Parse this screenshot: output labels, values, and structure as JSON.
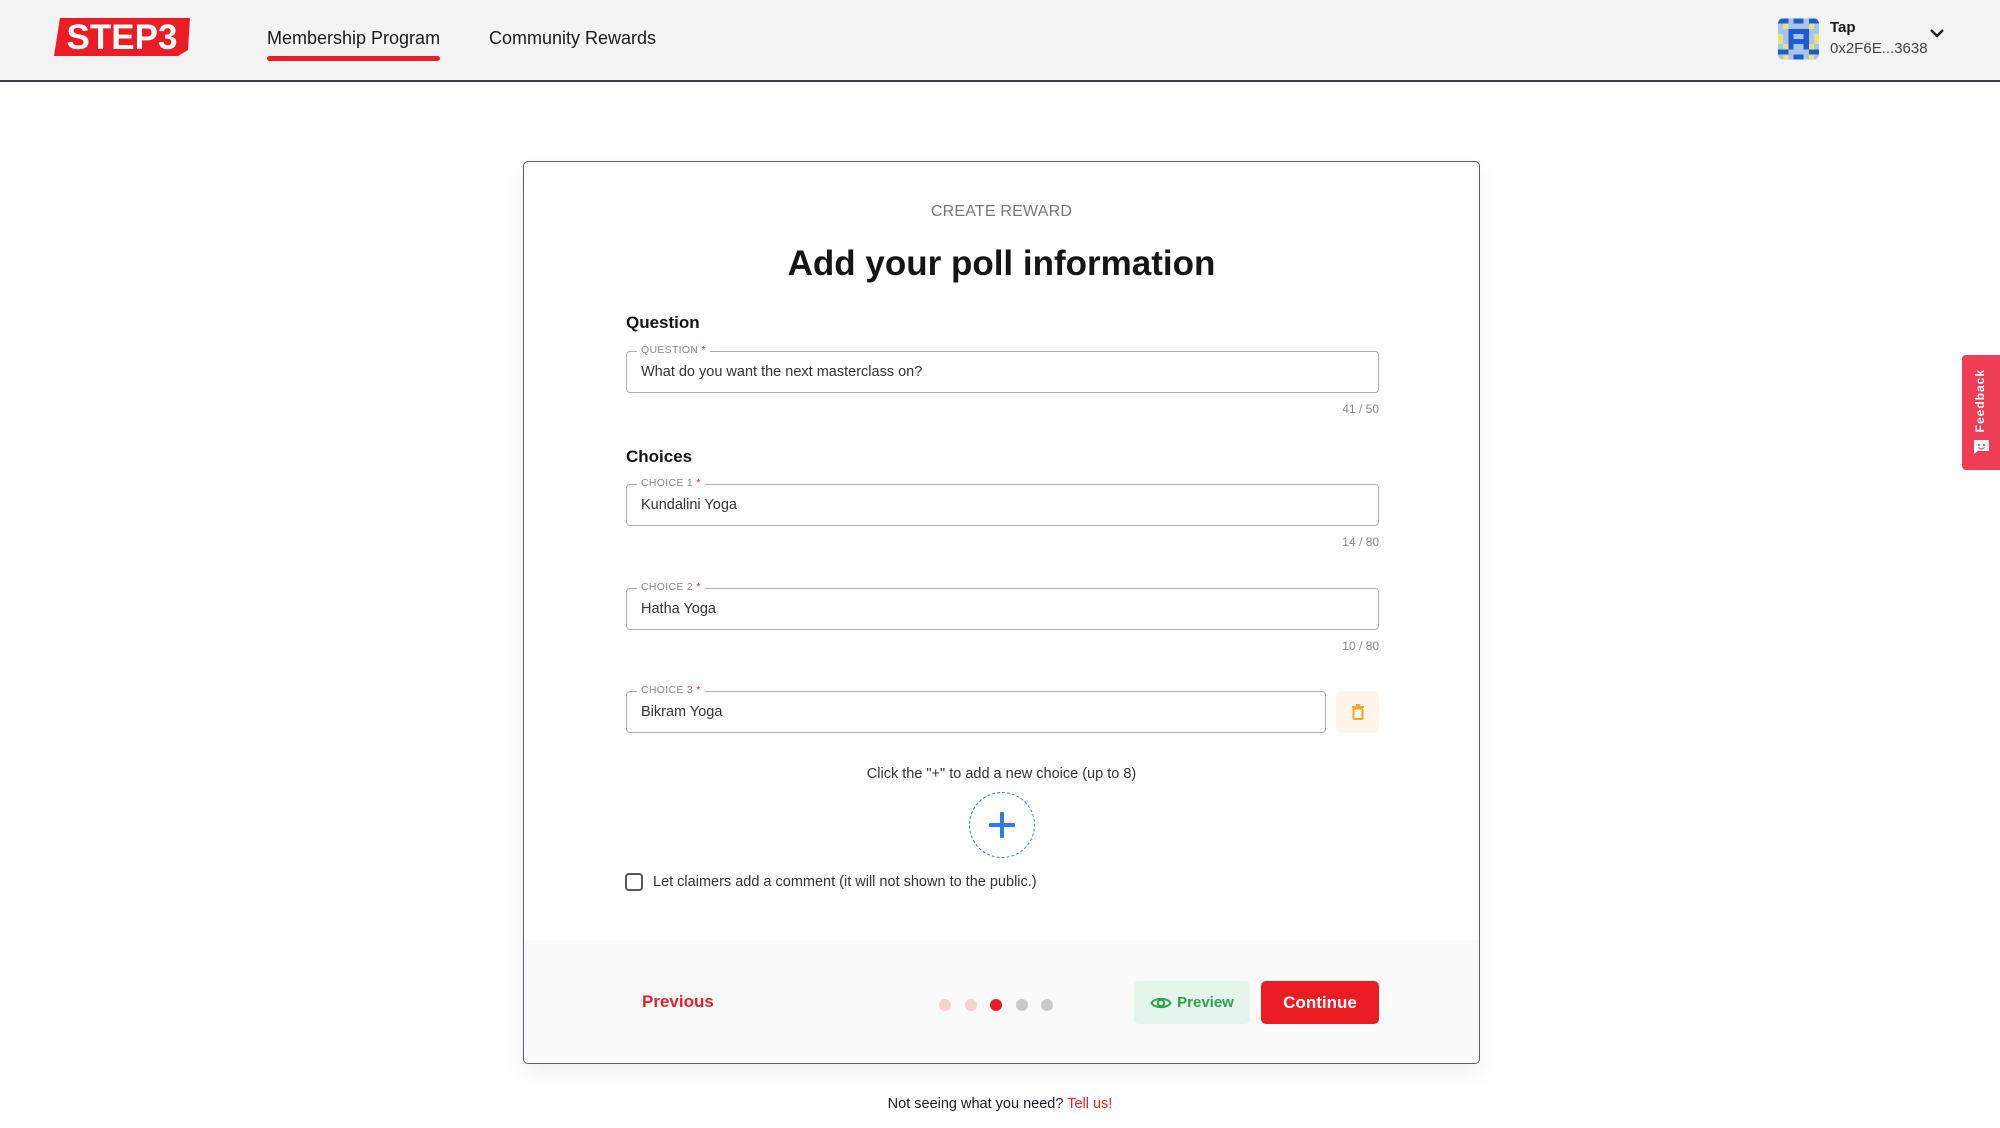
{
  "header": {
    "logo_text": "STEP3",
    "nav": [
      {
        "label": "Membership Program",
        "active": true
      },
      {
        "label": "Community Rewards",
        "active": false
      }
    ],
    "user": {
      "name": "Tap",
      "address": "0x2F6E...3638"
    }
  },
  "card": {
    "eyebrow": "CREATE REWARD",
    "title": "Add your poll information",
    "question_section": "Question",
    "question": {
      "legend": "QUESTION",
      "required_mark": "*",
      "value": "What do you want the next masterclass on?",
      "counter": "41 / 50"
    },
    "choices_section": "Choices",
    "choices": [
      {
        "legend": "CHOICE 1",
        "required_mark": "*",
        "value": "Kundalini Yoga",
        "counter": "14 / 80"
      },
      {
        "legend": "CHOICE 2",
        "required_mark": "*",
        "value": "Hatha Yoga",
        "counter": "10 / 80"
      },
      {
        "legend": "CHOICE 3",
        "required_mark": "*",
        "value": "Bikram Yoga"
      }
    ],
    "add_hint": "Click the \"+\" to add a new choice (up to 8)",
    "comment_checkbox": {
      "label": "Let claimers add a comment (it will not shown to the public.)",
      "checked": false
    },
    "footer": {
      "previous_label": "Previous",
      "preview_label": "Preview",
      "continue_label": "Continue",
      "steps_total": 5,
      "current_step": 3
    }
  },
  "bottom_note": {
    "text": "Not seeing what you need?",
    "link": "Tell us!"
  },
  "feedback_tab": {
    "label": "Feedback"
  },
  "colors": {
    "brand_red": "#ec1c24",
    "preview_green": "#2aa34a",
    "add_blue": "#3a82e8",
    "feedback_pink": "#ee3e55"
  }
}
